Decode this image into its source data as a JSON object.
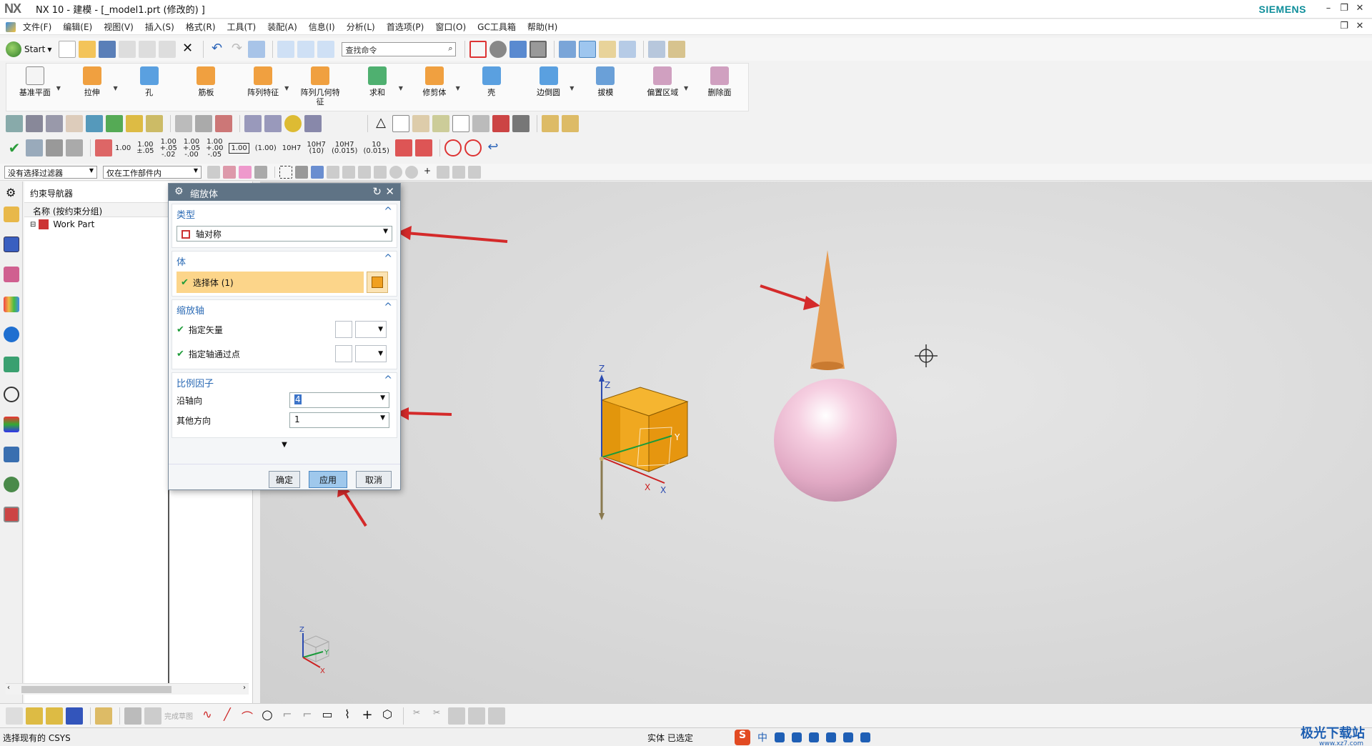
{
  "window": {
    "logo": "NX",
    "title": "NX 10 - 建模 - [_model1.prt  (修改的) ]",
    "brand": "SIEMENS"
  },
  "menu": {
    "items": [
      "文件(F)",
      "编辑(E)",
      "视图(V)",
      "插入(S)",
      "格式(R)",
      "工具(T)",
      "装配(A)",
      "信息(I)",
      "分析(L)",
      "首选项(P)",
      "窗口(O)",
      "GC工具箱",
      "帮助(H)"
    ]
  },
  "toolbar": {
    "start_label": "Start",
    "search_placeholder": "查找命令"
  },
  "ribbon": {
    "items": [
      {
        "label": "基准平面",
        "color": "#e9e9e9"
      },
      {
        "label": "拉伸",
        "color": "#f0a040"
      },
      {
        "label": "孔",
        "color": "#5aa0e0"
      },
      {
        "label": "筋板",
        "color": "#f0a040"
      },
      {
        "label": "阵列特征",
        "color": "#f0a040"
      },
      {
        "label": "阵列几何特征",
        "color": "#f0a040"
      },
      {
        "label": "求和",
        "color": "#4fb070"
      },
      {
        "label": "修剪体",
        "color": "#f0a040"
      },
      {
        "label": "壳",
        "color": "#5aa0e0"
      },
      {
        "label": "边倒圆",
        "color": "#5aa0e0"
      },
      {
        "label": "拔模",
        "color": "#6aa0d8"
      },
      {
        "label": "偏置区域",
        "color": "#d0a0c0"
      },
      {
        "label": "删除面",
        "color": "#d0a0c0"
      }
    ]
  },
  "tolerances": [
    "1.00",
    "1.00\n±.05",
    "1.00\n+.05\n-.02",
    "1.00\n+.05\n-.00",
    "1.00\n+.00\n-.05",
    "1.00",
    "(1.00)",
    "10H7",
    "10H7\n(10)",
    "10H7\n(0.015)",
    "10\n(0.015)"
  ],
  "filters": {
    "selection_filter": "没有选择过滤器",
    "scope": "仅在工作部件内"
  },
  "navigator": {
    "title": "约束导航器",
    "column_header": "名称 (按约束分组)",
    "root": "Work Part"
  },
  "dialog": {
    "title": "缩放体",
    "type_section": "类型",
    "type_value": "轴对称",
    "body_section": "体",
    "select_body": "选择体 (1)",
    "axis_section": "缩放轴",
    "specify_vector": "指定矢量",
    "specify_point": "指定轴通过点",
    "scale_section": "比例因子",
    "along_axis_label": "沿轴向",
    "along_axis_value": "4",
    "other_dir_label": "其他方向",
    "other_dir_value": "1",
    "ok": "确定",
    "apply": "应用",
    "cancel": "取消"
  },
  "axes": {
    "z": "Z",
    "y": "Y",
    "x": "X"
  },
  "bottom": {
    "finish_sketch": "完成草图"
  },
  "status": {
    "left": "选择现有的 CSYS",
    "middle": "实体 已选定"
  },
  "ime": {
    "s": "S",
    "zh": "中"
  },
  "watermark": {
    "main": "极光下载站",
    "sub": "www.xz7.com"
  },
  "colors": {
    "dialog_title": "#5f7385",
    "section_head": "#2c6bb5",
    "selection": "#fcd58a",
    "annotation_arrow": "#d42a2a"
  }
}
